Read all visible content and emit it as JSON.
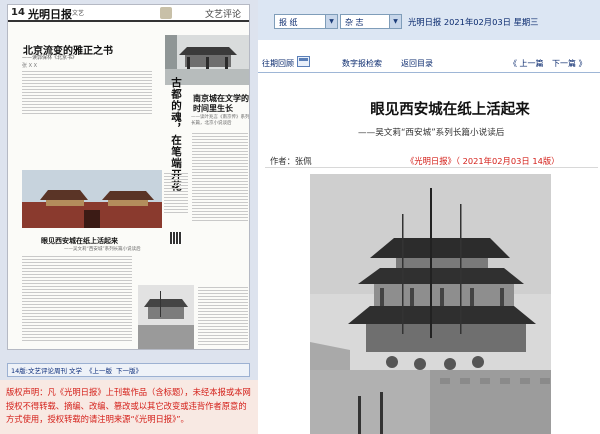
{
  "paper": {
    "page_no": "14",
    "masthead": "光明日报",
    "section": "文艺",
    "column_title": "文艺评论",
    "article1": {
      "title": "北京流变的雅正之书",
      "subtitle": "——读郭保林《北京书》",
      "byline": "张 X X"
    },
    "article2": {
      "vertical_title": "古都的魂，在笔端开花",
      "title": "南京城在文学的时间里生长",
      "subtitle": "——读叶兆言《南京传》系列长篇，北京小说谈后"
    },
    "article3": {
      "title": "眼见西安城在纸上活起来",
      "subtitle": "——吴文莉“西安城”系列长篇小说读后"
    }
  },
  "bottom_nav": {
    "edition": "14版:文艺评论周刊 文学",
    "prev": "《上一版",
    "next": "下一版》"
  },
  "copyright": "版权声明：凡《光明日报》上刊载作品（含标题），未经本报或本网授权不得转载、摘编、改编、篡改或以其它改变或违背作者原意的方式使用，授权转载的请注明来源“《光明日报》”。",
  "topbar": {
    "select1": "报    纸",
    "select2": "杂   志",
    "date_line": "光明日报  2021年02月03日  星期三"
  },
  "toolbar": {
    "history": "往期回顾",
    "digital": "数字报检索",
    "back": "返回目录",
    "prev": "《 上一篇",
    "next": "下一篇 》"
  },
  "article": {
    "headline": "眼见西安城在纸上活起来",
    "subhead": "——吴文莉“西安城”系列长篇小说读后",
    "author": "作者：张佩",
    "source": "《光明日报》（ 2021年02月03日   14版）"
  },
  "icons": {
    "calendar": "calendar-icon",
    "dropdown": "chevron-down-icon"
  },
  "colors": {
    "link_blue": "#0a2a6e",
    "accent_red": "#d4201a",
    "topbar_bg": "#dce6f3"
  }
}
